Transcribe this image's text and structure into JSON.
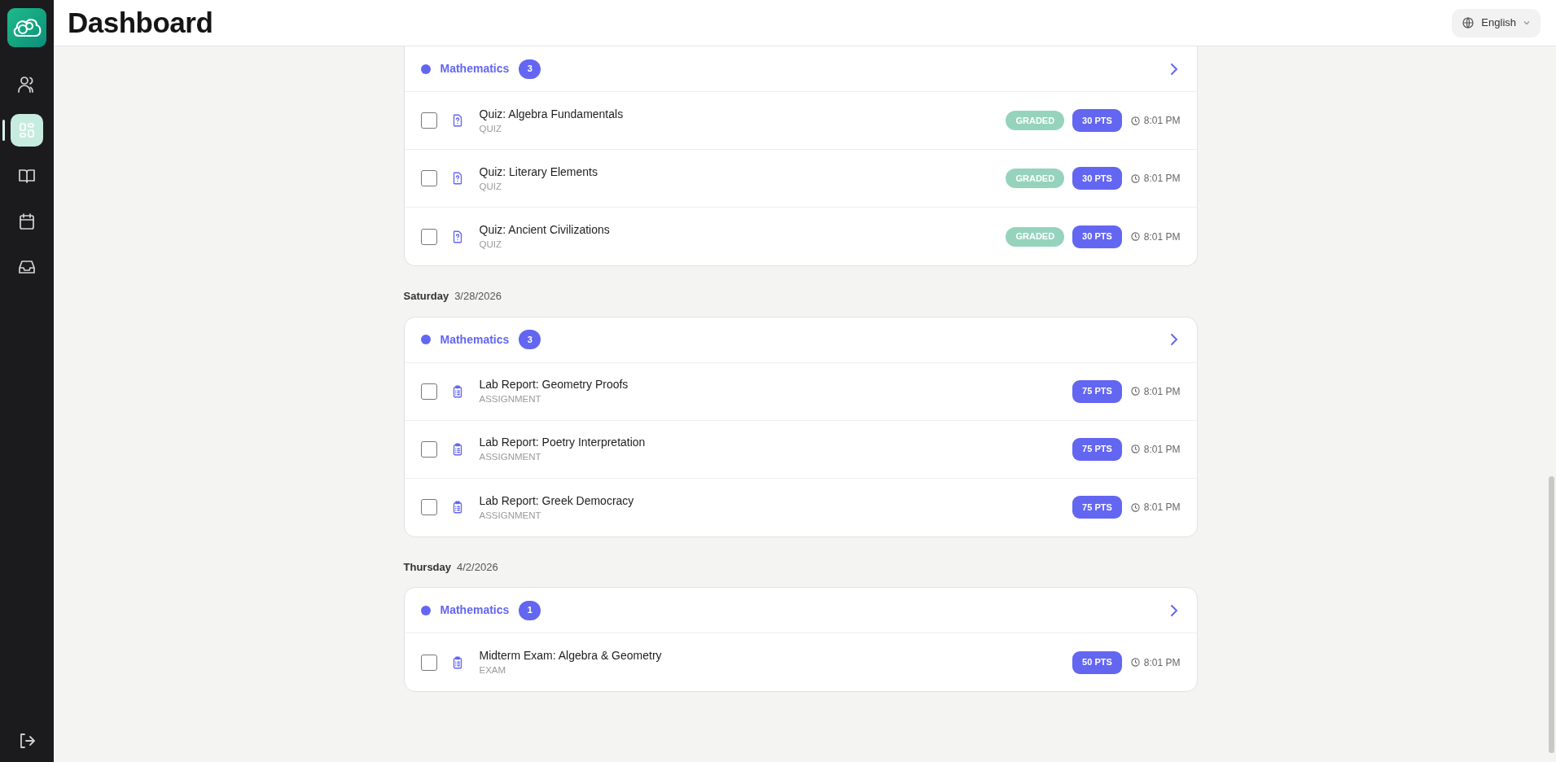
{
  "header": {
    "title": "Dashboard",
    "language": "English"
  },
  "sidebar": {
    "items": [
      {
        "kind": "users",
        "selected": false
      },
      {
        "kind": "dashboard",
        "selected": true
      },
      {
        "kind": "book",
        "selected": false
      },
      {
        "kind": "calendar",
        "selected": false
      },
      {
        "kind": "inbox",
        "selected": false
      }
    ]
  },
  "groups": [
    {
      "subject": {
        "name": "Mathematics",
        "count": "3",
        "color": "#6366f1"
      },
      "items": [
        {
          "kind": "quiz",
          "title": "Quiz: Algebra Fundamentals",
          "type": "QUIZ",
          "checked": false,
          "status": "GRADED",
          "points": "30 PTS",
          "time": "8:01 PM"
        },
        {
          "kind": "quiz",
          "title": "Quiz: Literary Elements",
          "type": "QUIZ",
          "checked": false,
          "status": "GRADED",
          "points": "30 PTS",
          "time": "8:01 PM"
        },
        {
          "kind": "quiz",
          "title": "Quiz: Ancient Civilizations",
          "type": "QUIZ",
          "checked": false,
          "status": "GRADED",
          "points": "30 PTS",
          "time": "8:01 PM"
        }
      ]
    },
    {
      "day": "Saturday",
      "date": "3/28/2026",
      "subject": {
        "name": "Mathematics",
        "count": "3",
        "color": "#6366f1"
      },
      "items": [
        {
          "kind": "assignment",
          "title": "Lab Report: Geometry Proofs",
          "type": "ASSIGNMENT",
          "checked": false,
          "points": "75 PTS",
          "time": "8:01 PM"
        },
        {
          "kind": "assignment",
          "title": "Lab Report: Poetry Interpretation",
          "type": "ASSIGNMENT",
          "checked": false,
          "points": "75 PTS",
          "time": "8:01 PM"
        },
        {
          "kind": "assignment",
          "title": "Lab Report: Greek Democracy",
          "type": "ASSIGNMENT",
          "checked": false,
          "points": "75 PTS",
          "time": "8:01 PM"
        }
      ]
    },
    {
      "day": "Thursday",
      "date": "4/2/2026",
      "subject": {
        "name": "Mathematics",
        "count": "1",
        "color": "#6366f1"
      },
      "items": [
        {
          "kind": "assignment",
          "title": "Midterm Exam: Algebra & Geometry",
          "type": "EXAM",
          "checked": false,
          "points": "50 PTS",
          "time": "8:01 PM"
        }
      ]
    }
  ]
}
